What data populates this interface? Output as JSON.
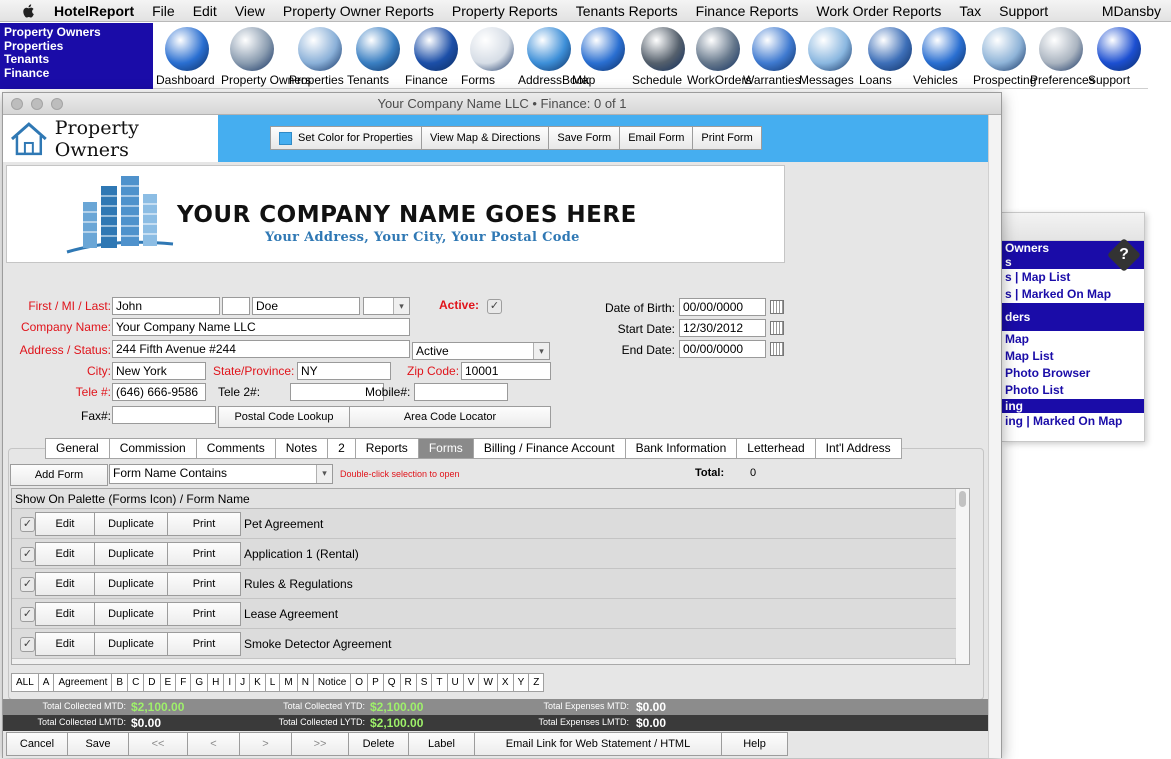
{
  "menubar": {
    "apple_icon": "apple-icon",
    "items": [
      "HotelReport",
      "File",
      "Edit",
      "View",
      "Property Owner Reports",
      "Property Reports",
      "Tenants Reports",
      "Finance Reports",
      "Work Order Reports",
      "Tax",
      "Support",
      "MDansby"
    ]
  },
  "nav": {
    "items": [
      "Property Owners",
      "Properties",
      "Tenants",
      "Finance"
    ]
  },
  "toolbar": {
    "buttons": [
      {
        "label": "Dashboard",
        "icon": "globe-icon",
        "color": "#2a6fd1"
      },
      {
        "label": "Property Owners",
        "icon": "building-icon",
        "color": "#8a9cb0"
      },
      {
        "label": "Properties",
        "icon": "house-icon",
        "color": "#8ab0d8"
      },
      {
        "label": "Tenants",
        "icon": "people-icon",
        "color": "#3a7fc2"
      },
      {
        "label": "Finance",
        "icon": "bank-icon",
        "color": "#1c4fa8"
      },
      {
        "label": "Forms",
        "icon": "document-icon",
        "color": "#d6dde6"
      },
      {
        "label": "AddressBook",
        "icon": "at-sign-icon",
        "color": "#3d8fd8"
      },
      {
        "label": "Map",
        "icon": "globe-map-icon",
        "color": "#2a6fd1"
      },
      {
        "label": "Schedule",
        "icon": "calendar-icon",
        "color": "#55606c"
      },
      {
        "label": "WorkOrders",
        "icon": "tools-icon",
        "color": "#66788c"
      },
      {
        "label": "Warranties",
        "icon": "warranty-badge-icon",
        "color": "#3f7ad0"
      },
      {
        "label": "Messages",
        "icon": "telephone-icon",
        "color": "#8ab7e0"
      },
      {
        "label": "Loans",
        "icon": "hourglass-icon",
        "color": "#3d6fb8"
      },
      {
        "label": "Vehicles",
        "icon": "car-icon",
        "color": "#2a6fd1"
      },
      {
        "label": "Prospecting",
        "icon": "towers-icon",
        "color": "#8fb4d8"
      },
      {
        "label": "Preferences",
        "icon": "wrench-screwdriver-icon",
        "color": "#aab4c0"
      },
      {
        "label": "Support",
        "icon": "question-icon",
        "color": "#1c4fd1"
      }
    ]
  },
  "window": {
    "title": "Your Company Name LLC  •  Finance: 0 of 1"
  },
  "header": {
    "module_title": "Property Owners",
    "buttons": [
      "Set Color for Properties",
      "View Map & Directions",
      "Save Form",
      "Email Form",
      "Print Form"
    ],
    "accent": "#45aef0"
  },
  "banner": {
    "company_name": "YOUR COMPANY NAME GOES HERE",
    "address": "Your Address, Your City, Your Postal Code"
  },
  "form": {
    "name_label": "First / MI / Last:",
    "first": "John",
    "mi": "",
    "last": "Doe",
    "suffix": "",
    "active_label": "Active:",
    "company_label": "Company Name:",
    "company": "Your Company Name LLC",
    "address_label": "Address / Status:",
    "address": "244 Fifth Avenue #244",
    "status": "Active",
    "city_label": "City:",
    "city": "New York",
    "state_label": "State/Province:",
    "state": "NY",
    "zip_label": "Zip Code:",
    "zip": "10001",
    "tele_label": "Tele #:",
    "tele": "(646) 666-9586",
    "tele2_label": "Tele 2#:",
    "tele2": "",
    "mobile_label": "Mobile#:",
    "mobile": "",
    "fax_label": "Fax#:",
    "fax": "",
    "postal_lookup": "Postal Code Lookup",
    "area_locator": "Area Code Locator",
    "dob_label": "Date of  Birth:",
    "dob": "00/00/0000",
    "start_label": "Start Date:",
    "start": "12/30/2012",
    "end_label": "End Date:",
    "end": "00/00/0000"
  },
  "tabs": [
    "General",
    "Commission",
    "Comments",
    "Notes",
    "2",
    "Reports",
    "Forms",
    "Billing / Finance Account",
    "Bank Information",
    "Letterhead",
    "Int'l Address"
  ],
  "forms_panel": {
    "add_form": "Add Form",
    "filter": "Form Name Contains",
    "hint": "Double-click selection to open",
    "total_label": "Total:",
    "total": "0",
    "column_header": "Show On Palette (Forms Icon) / Form Name",
    "edit_label": "Edit",
    "duplicate_label": "Duplicate",
    "print_label": "Print",
    "rows": [
      "Pet Agreement",
      "Application 1 (Rental)",
      "Rules & Regulations",
      "Lease Agreement",
      "Smoke Detector Agreement"
    ]
  },
  "alpha": [
    "ALL",
    "A",
    "Agreement",
    "B",
    "C",
    "D",
    "E",
    "F",
    "G",
    "H",
    "I",
    "J",
    "K",
    "L",
    "M",
    "N",
    "Notice",
    "O",
    "P",
    "Q",
    "R",
    "S",
    "T",
    "U",
    "V",
    "W",
    "X",
    "Y",
    "Z"
  ],
  "summary": {
    "collected_mtd_label": "Total Collected MTD:",
    "collected_mtd": "$2,100.00",
    "collected_ytd_label": "Total Collected YTD:",
    "collected_ytd": "$2,100.00",
    "expenses_mtd_label": "Total Expenses MTD:",
    "expenses_mtd": "$0.00",
    "collected_lmtd_label": "Total Collected LMTD:",
    "collected_lmtd": "$0.00",
    "collected_lytd_label": "Total Collected LYTD:",
    "collected_lytd": "$2,100.00",
    "expenses_lmtd_label": "Total Expenses LMTD:",
    "expenses_lmtd": "$0.00"
  },
  "bottom": {
    "cancel": "Cancel",
    "save": "Save",
    "first": "<<",
    "prev": "<",
    "next": ">",
    "last": ">>",
    "delete": "Delete",
    "label": "Label",
    "email_link": "Email Link for Web Statement / HTML",
    "help": "Help"
  },
  "sidepanel": {
    "bar1": "Owners",
    "bar1b": "s",
    "link1": "s | Map List",
    "link2": "s | Marked On Map",
    "bar2": "ders",
    "link3": "Map",
    "link4": "Map List",
    "link5": "Photo Browser",
    "link6": "Photo List",
    "bar3": "ing",
    "link7": "ing | Marked On Map",
    "help": "?"
  }
}
